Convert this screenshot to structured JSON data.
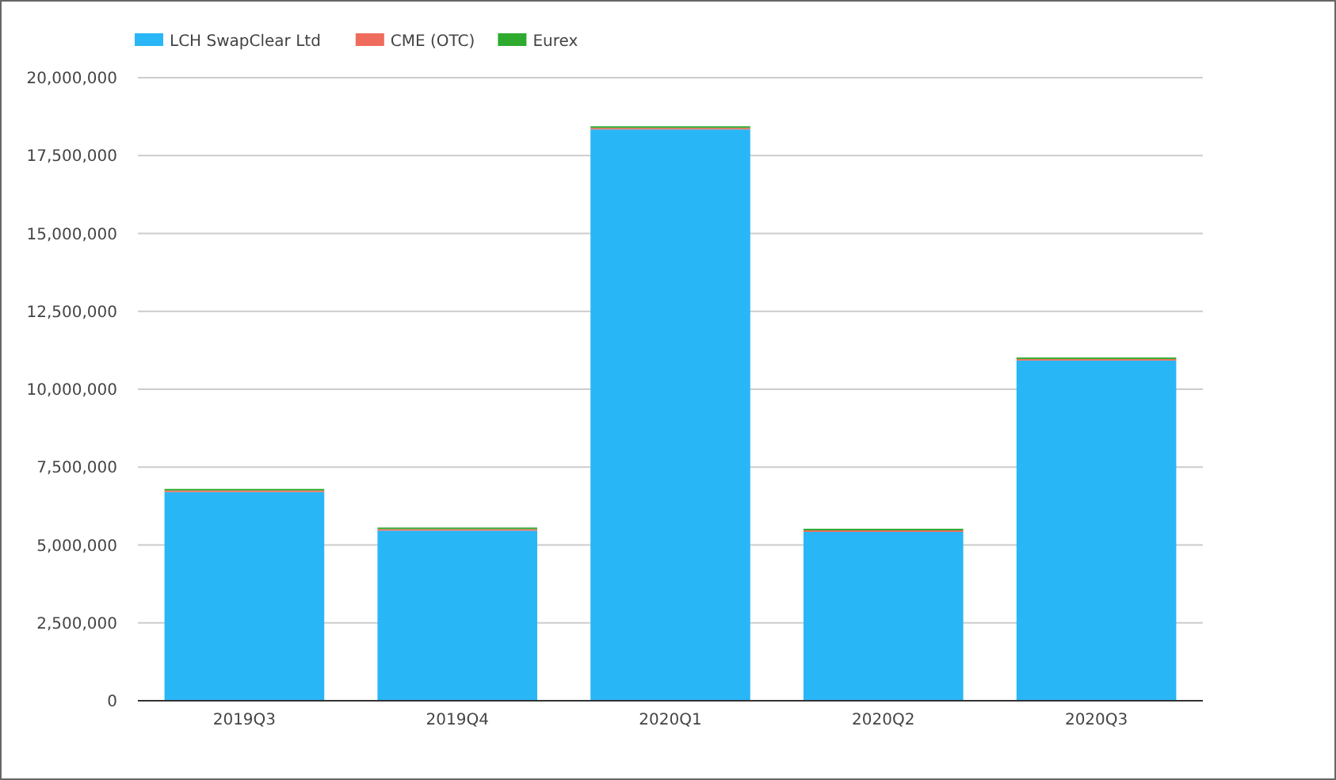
{
  "chart_data": {
    "type": "bar",
    "stacked": true,
    "grid": true,
    "legend": true,
    "categories": [
      "2019Q3",
      "2019Q4",
      "2020Q1",
      "2020Q2",
      "2020Q3"
    ],
    "series": [
      {
        "name": "LCH SwapClear Ltd",
        "color": "#29b6f6",
        "values": [
          6700000,
          5460000,
          18340000,
          5420000,
          10920000
        ]
      },
      {
        "name": "CME (OTC)",
        "color": "#ef6c5c",
        "values": [
          50000,
          50000,
          50000,
          50000,
          50000
        ]
      },
      {
        "name": "Eurex",
        "color": "#2eaa2e",
        "values": [
          50000,
          50000,
          50000,
          50000,
          50000
        ]
      }
    ],
    "ylim": [
      0,
      20000000
    ],
    "yticks": [
      {
        "value": 0,
        "label": "0"
      },
      {
        "value": 2500000,
        "label": "2,500,000"
      },
      {
        "value": 5000000,
        "label": "5,000,000"
      },
      {
        "value": 7500000,
        "label": "7,500,000"
      },
      {
        "value": 10000000,
        "label": "10,000,000"
      },
      {
        "value": 12500000,
        "label": "12,500,000"
      },
      {
        "value": 15000000,
        "label": "15,000,000"
      },
      {
        "value": 17500000,
        "label": "17,500,000"
      },
      {
        "value": 20000000,
        "label": "20,000,000"
      }
    ]
  }
}
